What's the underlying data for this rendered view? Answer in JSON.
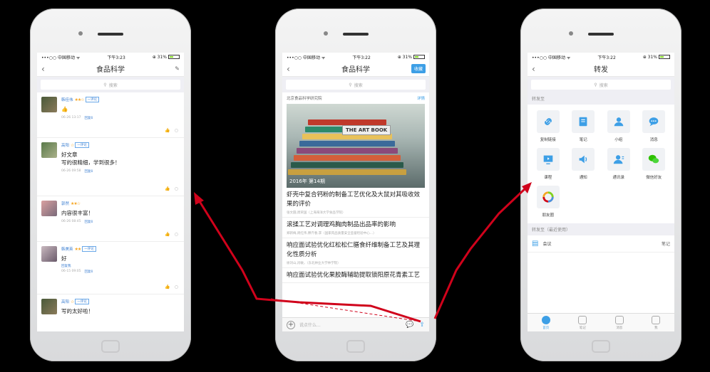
{
  "status": {
    "carrier": "•••○○ 中国移动 ᯤ",
    "time1": "下午3:23",
    "time2": "下午3:22",
    "time3": "下午3:22",
    "battery": "⊕ 31%"
  },
  "phone1": {
    "title": "食品科学",
    "back": "‹",
    "search_placeholder": "搜索",
    "comments": [
      {
        "user": "韩佳伟",
        "stars": "★★☆",
        "tag": "一评论",
        "text": "👍",
        "time": "06-26 13:17",
        "reply": "回复ß"
      },
      {
        "user": "高阳",
        "stars": "☆",
        "tag": "一评论",
        "text": "好文章\n写的很精细，学到很多！",
        "time": "06-26 09:58",
        "reply": "回复ß"
      },
      {
        "user": "郭然",
        "stars": "★★☆",
        "tag": "",
        "text": "内容很丰富！",
        "time": "06-26 08:45",
        "reply": "回复ß"
      },
      {
        "user": "韩美英",
        "stars": "★★",
        "tag": "一评论",
        "text": "好",
        "time": "06-15 09:05",
        "reply": "回复ß",
        "extra": "回复我"
      },
      {
        "user": "高阳",
        "stars": "☆",
        "tag": "一评论",
        "text": "写的太好啦！",
        "time": "",
        "reply": ""
      }
    ]
  },
  "phone2": {
    "title": "食品科学",
    "fav": "收藏",
    "search_placeholder": "搜索",
    "org": "北京食品科学研究院",
    "org_more": "详情",
    "banner_book": "THE ART BOOK",
    "banner_caption": "2016年 第14期",
    "articles": [
      {
        "title": "虾壳中复合钙粉的制备工艺优化及大鼠对其吸收效果的评价",
        "sub": "张文圆,周荣国（上海海洋大学食品学院）"
      },
      {
        "title": "滚揉工艺对调理鸡胸肉制品出品率的影响",
        "sub": "郑新梅,周红伟,穆斤春,李（国家肉品质量安全监督检验中心...）"
      },
      {
        "title": "响应面试验优化红松松仁膳食纤维制备工艺及其理化性质分析",
        "sub": "徐刘山,肖敏，（东北林业大学林学院）"
      },
      {
        "title": "响应面试验优化果胶酶辅助提取锁阳原花青素工艺",
        "sub": ""
      }
    ],
    "input_placeholder": "说点什么..."
  },
  "phone3": {
    "title": "转发",
    "search_placeholder": "搜索",
    "section1": "转发至",
    "items": [
      {
        "label": "复制链接",
        "icon": "link-icon"
      },
      {
        "label": "笔记",
        "icon": "note-icon"
      },
      {
        "label": "小组",
        "icon": "group-icon"
      },
      {
        "label": "消息",
        "icon": "message-icon"
      },
      {
        "label": "课程",
        "icon": "course-icon"
      },
      {
        "label": "通知",
        "icon": "notice-icon"
      },
      {
        "label": "通讯录",
        "icon": "contacts-icon"
      },
      {
        "label": "微信好友",
        "icon": "wechat-icon"
      },
      {
        "label": "朋友圈",
        "icon": "moments-icon"
      }
    ],
    "section2": "转发至（最近使用）",
    "recent_label": "会议",
    "recent_right": "笔记",
    "tabs": [
      "首页",
      "笔记",
      "消息",
      "我"
    ]
  },
  "colors": {
    "accent": "#3d9fe6",
    "arrow": "#d0021b"
  }
}
